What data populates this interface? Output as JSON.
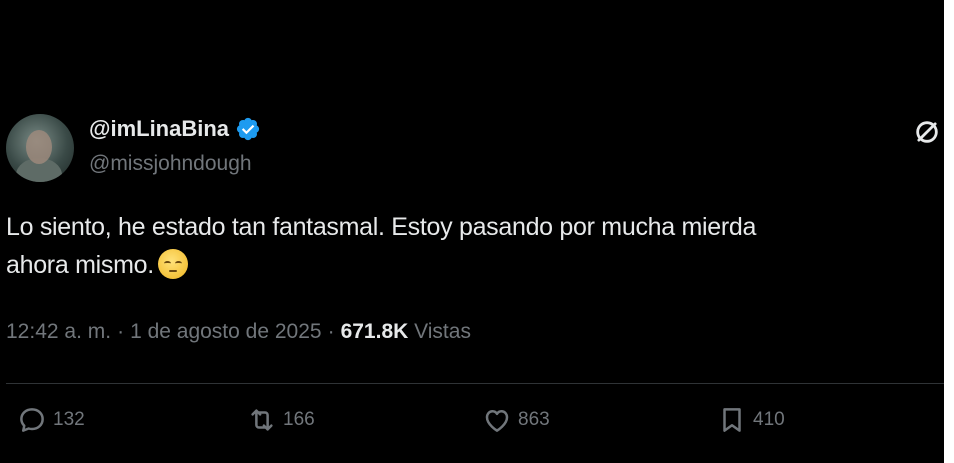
{
  "author": {
    "display_name": "@imLinaBina",
    "handle": "@missjohndough",
    "verified": true
  },
  "tweet": {
    "text_line1": "Lo siento, he estado tan fantasmal. Estoy pasando por mucha mierda",
    "text_line2": "ahora mismo.",
    "emoji": "pensive-face"
  },
  "meta": {
    "time": "12:42 a. m.",
    "separator1": "·",
    "date": "1 de agosto de 2025",
    "separator2": "·",
    "views_count": "671.8K",
    "views_label": "Vistas"
  },
  "actions": {
    "replies": "132",
    "retweets": "166",
    "likes": "863",
    "bookmarks": "410"
  },
  "colors": {
    "background": "#000000",
    "text": "#e7e9ea",
    "secondary": "#71767b",
    "verified": "#1d9bf0",
    "divider": "#2f3336"
  },
  "icons": [
    "verified-badge-icon",
    "grok-icon",
    "reply-icon",
    "retweet-icon",
    "like-icon",
    "bookmark-icon"
  ]
}
